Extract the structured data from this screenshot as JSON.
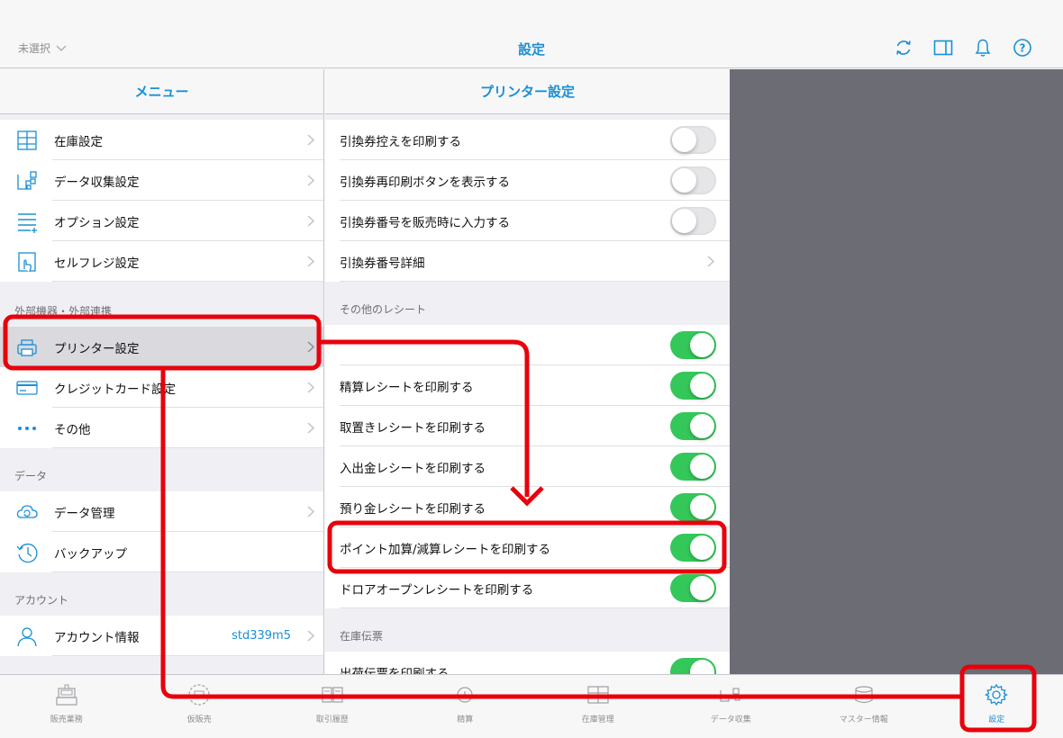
{
  "topbar": {
    "store_select": "未選択",
    "title": "設定",
    "icons": [
      "refresh-icon",
      "sidebar-toggle-icon",
      "bell-icon",
      "help-icon"
    ]
  },
  "menu": {
    "header": "メニュー",
    "items_top": [
      {
        "label": "在庫設定",
        "icon": "inventory-grid-icon"
      },
      {
        "label": "データ収集設定",
        "icon": "data-flow-icon"
      },
      {
        "label": "オプション設定",
        "icon": "options-list-icon"
      },
      {
        "label": "セルフレジ設定",
        "icon": "self-checkout-icon"
      }
    ],
    "section_external": "外部機器・外部連携",
    "items_external": [
      {
        "label": "プリンター設定",
        "icon": "printer-icon"
      },
      {
        "label": "クレジットカード設定",
        "icon": "credit-card-icon"
      },
      {
        "label": "その他",
        "icon": "more-dots-icon"
      }
    ],
    "section_data": "データ",
    "items_data": [
      {
        "label": "データ管理",
        "icon": "cloud-icon"
      },
      {
        "label": "バックアップ",
        "icon": "history-clock-icon"
      }
    ],
    "section_account": "アカウント",
    "account": {
      "label": "アカウント情報",
      "value": "std339m5",
      "icon": "person-icon"
    }
  },
  "printer": {
    "header": "プリンター設定",
    "rows_top": [
      {
        "label": "引換券控えを印刷する",
        "toggle": "off"
      },
      {
        "label": "引換券再印刷ボタンを表示する",
        "toggle": "off"
      },
      {
        "label": "引換券番号を販売時に入力する",
        "toggle": "off"
      },
      {
        "label": "引換券番号詳細",
        "toggle": "chevron"
      }
    ],
    "section_other": "その他のレシート",
    "rows_other": [
      {
        "label": "",
        "toggle": "on"
      },
      {
        "label": "精算レシートを印刷する",
        "toggle": "on"
      },
      {
        "label": "取置きレシートを印刷する",
        "toggle": "on"
      },
      {
        "label": "入出金レシートを印刷する",
        "toggle": "on"
      },
      {
        "label": "預り金レシートを印刷する",
        "toggle": "on"
      },
      {
        "label": "ポイント加算/減算レシートを印刷する",
        "toggle": "on"
      },
      {
        "label": "ドロアオープンレシートを印刷する",
        "toggle": "on"
      }
    ],
    "section_stock": "在庫伝票",
    "rows_stock": [
      {
        "label": "出荷伝票を印刷する",
        "toggle": "on"
      }
    ]
  },
  "tabbar": {
    "tabs": [
      {
        "label": "販売業務",
        "icon": "register-icon"
      },
      {
        "label": "仮販売",
        "icon": "temp-sale-icon"
      },
      {
        "label": "取引履歴",
        "icon": "receipt-history-icon"
      },
      {
        "label": "精算",
        "icon": "settlement-icon"
      },
      {
        "label": "在庫管理",
        "icon": "inventory-icon"
      },
      {
        "label": "データ収集",
        "icon": "data-collect-icon"
      },
      {
        "label": "マスター情報",
        "icon": "database-icon"
      },
      {
        "label": "設定",
        "icon": "gear-icon",
        "active": true
      }
    ]
  },
  "colors": {
    "accent": "#1a8fd4",
    "toggle_on": "#34c759",
    "annotation": "#e8000b",
    "detail_bg": "#6c6d74"
  }
}
